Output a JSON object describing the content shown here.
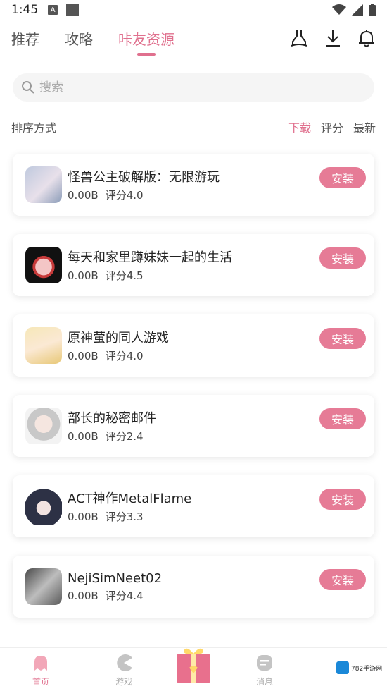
{
  "status_bar": {
    "time": "1:45",
    "a_badge": "A"
  },
  "top_nav": {
    "tabs": [
      {
        "label": "推荐",
        "active": false
      },
      {
        "label": "攻略",
        "active": false
      },
      {
        "label": "咔友资源",
        "active": true
      }
    ],
    "icons": [
      "broom-icon",
      "download-icon",
      "bell-icon"
    ]
  },
  "search": {
    "placeholder": "搜索"
  },
  "sort": {
    "label": "排序方式",
    "options": [
      {
        "label": "下载",
        "active": true
      },
      {
        "label": "评分",
        "active": false
      },
      {
        "label": "最新",
        "active": false
      }
    ]
  },
  "items": [
    {
      "title": "怪兽公主破解版：无限游玩",
      "size": "0.00B",
      "rating": "评分4.0",
      "button": "安装",
      "thumb_color": "#c9d3e6"
    },
    {
      "title": "每天和家里蹲妹妹一起的生活",
      "size": "0.00B",
      "rating": "评分4.5",
      "button": "安装",
      "thumb_color": "#1a1a1a"
    },
    {
      "title": "原神萤的同人游戏",
      "size": "0.00B",
      "rating": "评分4.0",
      "button": "安装",
      "thumb_color": "#f2e3b0"
    },
    {
      "title": "部长的秘密邮件",
      "size": "0.00B",
      "rating": "评分2.4",
      "button": "安装",
      "thumb_color": "#d8d8d8"
    },
    {
      "title": "ACT神作MetalFlame",
      "size": "0.00B",
      "rating": "评分3.3",
      "button": "安装",
      "thumb_color": "#3a3f55"
    },
    {
      "title": "NejiSimNeet02",
      "size": "0.00B",
      "rating": "评分4.4",
      "button": "安装",
      "thumb_color": "#6b6b6b"
    }
  ],
  "bottom_nav": {
    "items": [
      {
        "label": "首页",
        "active": true
      },
      {
        "label": "游戏",
        "active": false
      },
      {
        "label": "消息",
        "active": false
      }
    ]
  },
  "watermark": "782手游网",
  "colors": {
    "accent": "#e0708e",
    "button": "#e67b96"
  }
}
